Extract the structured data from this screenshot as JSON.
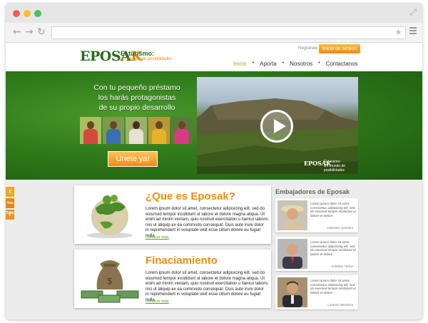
{
  "browser": {
    "back_icon": "back-arrow-icon",
    "forward_icon": "forward-arrow-icon",
    "reload_icon": "reload-icon",
    "url": ""
  },
  "site": {
    "logo_main": "EPOSA",
    "logo_k": "K",
    "tagline_title": "El turismo:",
    "tagline_sub": "Un mundo de posibilidades",
    "register": "Registrate",
    "login": "Inicio de sesion",
    "nav": [
      {
        "label": "Inicio",
        "active": true
      },
      {
        "label": "Aporta",
        "active": false
      },
      {
        "label": "Nosotros",
        "active": false
      },
      {
        "label": "Contactanos",
        "active": false
      }
    ]
  },
  "hero": {
    "line1": "Con tu pequeño préstamo",
    "line2": "los harás protagonistas",
    "line3": "de su propio desarrollo",
    "cta": "Unete ya!",
    "video_logo": "EPOSAK",
    "video_tag_1": "El turismo:",
    "video_tag_2": "Un mundo de posibilidades"
  },
  "social": {
    "twitter": "t",
    "youtube": "You Tube",
    "facebook": "f"
  },
  "cards": [
    {
      "title": "¿Que es Eposak?",
      "text": "Lorem ipsum dolor sit amet, consectetur adipisicing elit, sed do eiusmod tempor incididunt ut labore et dolore magna aliqua. Ut enim ad minim veniam, quis nostrud exercitation u llamco laboris nisi ut aliquip ex ea commodo consequat. Duis aute irure dolor in reprehenderit in voluptate velit esse cillum dolore eu fugiat nulla",
      "link": "Conocer más"
    },
    {
      "title": "Finaciamiento",
      "text": "Lorem ipsum dolor sit amet, consectetur adipisicing elit, sed do eiusmod tempor incididunt ut labore et dolore magna aliqua. Ut enim ad minim veniam, quis nostrud exercitation u llamco laboris nisi ut aliquip ex ea commodo consequat. Duis aute irure dolor in reprehenderit in voluptate velit esse cillum dolore eu fugiat nulla",
      "link": "Conocer más"
    }
  ],
  "ambassadors": {
    "title": "Embajadores de Eposak",
    "items": [
      {
        "quote": "Lorem ipsum dolor sit amet, consectetur adipisicing elit, sed do eiusmod tempor incididunt ut labore et dolore",
        "name": "- Valentina Quintero -"
      },
      {
        "quote": "Lorem ipsum dolor sit amet, consectetur adipisicing elit, sed do eiusmod tempor incididunt ut labore et dolore",
        "name": "- Esteban Torbar -"
      },
      {
        "quote": "Lorem ipsum dolor sit amet, consectetur adipisicing elit, sed do eiusmod tempor incididunt ut labore et dolore",
        "name": "- Lorenzo Mendoza -"
      }
    ]
  },
  "colors": {
    "brand_green": "#2b6a1c",
    "brand_orange": "#e8861b",
    "nav_active": "#8cba1f"
  }
}
